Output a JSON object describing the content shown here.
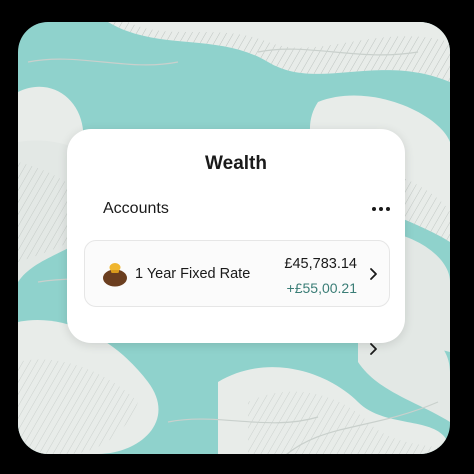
{
  "wealth_card": {
    "title": "Wealth",
    "accounts_label": "Accounts",
    "more_icon": "more-horizontal-icon"
  },
  "accounts": [
    {
      "name": "1 Year Fixed Rate",
      "balance": "£45,783.14",
      "change": "+£55,00.21",
      "icon": "money-bag-icon"
    }
  ],
  "colors": {
    "page_background": "#000000",
    "sky": "#8fd2cc",
    "cloud": "#e8ece9",
    "card": "#ffffff",
    "positive_change": "#3a7d76"
  }
}
